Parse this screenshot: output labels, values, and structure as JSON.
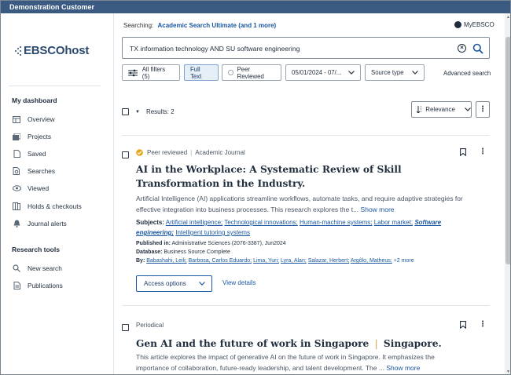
{
  "window": {
    "title": "Demonstration Customer"
  },
  "brand": {
    "logo_text": "EBSCOhost"
  },
  "sidebar": {
    "dashboard_heading": "My dashboard",
    "items": [
      {
        "label": "Overview",
        "icon": "overview-icon"
      },
      {
        "label": "Projects",
        "icon": "projects-icon"
      },
      {
        "label": "Saved",
        "icon": "saved-icon"
      },
      {
        "label": "Searches",
        "icon": "searches-icon"
      },
      {
        "label": "Viewed",
        "icon": "eye-icon"
      },
      {
        "label": "Holds & checkouts",
        "icon": "holds-icon"
      },
      {
        "label": "Journal alerts",
        "icon": "bell-icon"
      }
    ],
    "research_heading": "Research tools",
    "research_items": [
      {
        "label": "New search",
        "icon": "search-icon"
      },
      {
        "label": "Publications",
        "icon": "publications-icon"
      }
    ]
  },
  "header": {
    "searching_label": "Searching:",
    "searching_db": "Academic Search Ultimate (and 1 more)",
    "account_label": "MyEBSCO"
  },
  "search": {
    "query": "TX information technology AND SU software engineering"
  },
  "filters": {
    "all_filters": "All filters (5)",
    "full_text": "Full Text",
    "peer_reviewed": "Peer Reviewed",
    "date_range": "05/01/2024 - 07/...",
    "source_type": "Source type",
    "advanced": "Advanced search"
  },
  "results": {
    "count_label": "Results: 2",
    "sort_label": "Relevance"
  },
  "articles": [
    {
      "peer_label": "Peer reviewed",
      "type": "Academic Journal",
      "title": "AI in the Workplace: A Systematic Review of Skill Transformation in the Industry.",
      "abstract": "Artificial Intelligence (AI) applications streamline workflows, automate tasks, and require adaptive strategies for effective integration into business processes. This research explores the t...",
      "show_more": "Show more",
      "subjects_label": "Subjects:",
      "subjects": [
        "Artificial intelligence;",
        "Technological innovations;",
        "Human-machine systems;",
        "Labor market;",
        "Software engineering;",
        "Intelligent tutoring systems"
      ],
      "published_label": "Published in:",
      "published": "Administrative Sciences (2076-3387), Jun2024",
      "database_label": "Database:",
      "database": "Business Source Complete",
      "by_label": "By:",
      "authors": [
        "Babashahi, Leili;",
        "Barbosa, Carlos Eduardo;",
        "Lima, Yuri;",
        "Lyra, Alan;",
        "Salazar, Herbert;",
        "Argôlo, Matheus;",
        "+2 more"
      ],
      "access_label": "Access options",
      "view_details": "View details"
    },
    {
      "type": "Periodical",
      "title_main": "Gen AI and the future of work in Singapore",
      "title_sep": "|",
      "title_tail": "Singapore.",
      "abstract": "This article explores the impact of generative AI on the future of work in Singapore. It emphasizes the importance of collaboration, future-ready leadership, and talent development. The ...",
      "show_more": "Show more"
    }
  ]
}
